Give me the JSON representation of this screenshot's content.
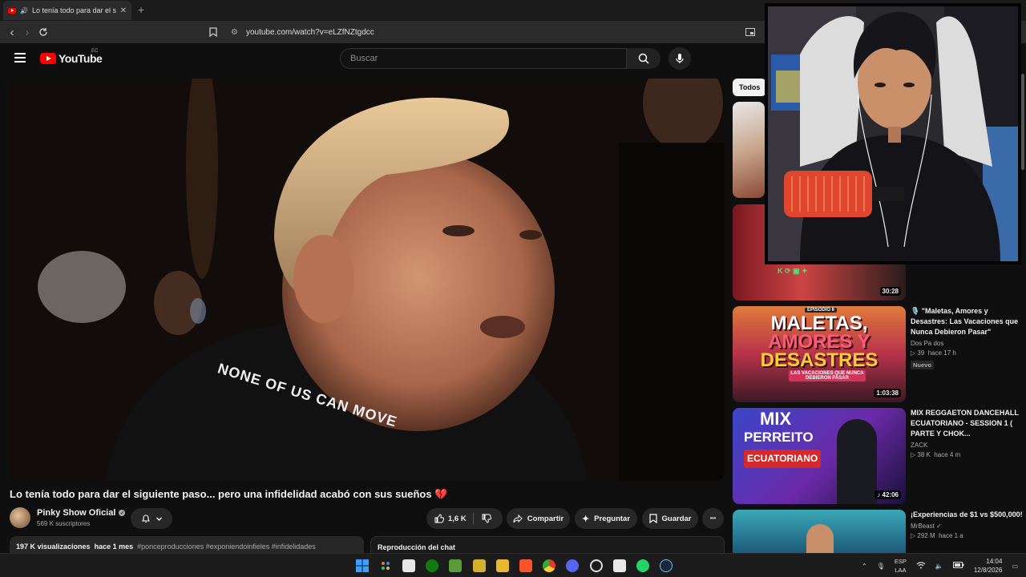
{
  "browser": {
    "tab_title": "Lo tenía todo para dar el sigu",
    "tab_close": "✕",
    "new_tab": "+",
    "url": "youtube.com/watch?v=eLZfNZtgdcc"
  },
  "youtube": {
    "logo_text": "YouTube",
    "country_code": "EC",
    "search_placeholder": "Buscar"
  },
  "video": {
    "title": "Lo tenía todo para dar el siguiente paso... pero una infidelidad acabó con sus sueños",
    "title_emoji": "💔",
    "channel": "Pinky Show Oficial",
    "subscribers": "569 K suscriptores",
    "likes": "1,6 K",
    "share_label": "Compartir",
    "ask_label": "Preguntar",
    "save_label": "Guardar",
    "more_label": "•••",
    "views": "197 K visualizaciones",
    "published": "hace 1 mes",
    "hashtags": "#ponceproducciones #exponiendoinfieles #infidelidades",
    "shirt_text": "NONE OF US CAN MOVE"
  },
  "chat": {
    "label": "Reproducción del chat"
  },
  "sidebar": {
    "chip_all": "Todos",
    "items": [
      {
        "title": "",
        "channel": "",
        "views": "",
        "age": "",
        "duration": "",
        "badge": ""
      },
      {
        "title": "",
        "channel": "",
        "views": "",
        "age": "",
        "duration": "30:28",
        "badge": ""
      },
      {
        "title": "🎙️ \"Maletas, Amores y Desastres: Las Vacaciones que Nunca Debieron Pasar\"",
        "channel": "Dos Pa dos",
        "views": "39",
        "age": "hace 17 h",
        "duration": "1:03:38",
        "badge": "Nuevo",
        "thumb_text": {
          "episode": "EPISODIO 6",
          "line1": "MALETAS,",
          "line2": "AMORES Y",
          "line3": "DESASTRES",
          "sub": "LAS VACACIONES QUE NUNCA DEBIERON PASAR"
        }
      },
      {
        "title": "MIX REGGAETON DANCEHALL ECUATORIANO - SESSION 1 ( PARTE Y CHOK...",
        "channel": "ZACK",
        "views": "38 K",
        "age": "hace 4 m",
        "duration": "42:06",
        "badge": "",
        "thumb_text": {
          "line1": "MIX",
          "line2": "PERREITO",
          "line3": "ECUATORIANO"
        }
      },
      {
        "title": "¡Experiencias de $1 vs $500,000!",
        "channel": "MrBeast",
        "views": "292 M",
        "age": "hace 1 a",
        "duration": "",
        "badge": ""
      }
    ]
  },
  "taskbar": {
    "lang_line1": "ESP",
    "lang_line2": "LAA",
    "time": "14:04",
    "date": "12/8/2026"
  },
  "colors": {
    "background": "#0f0f0f",
    "yt_red": "#ff0000",
    "chip_bg": "#272727"
  }
}
